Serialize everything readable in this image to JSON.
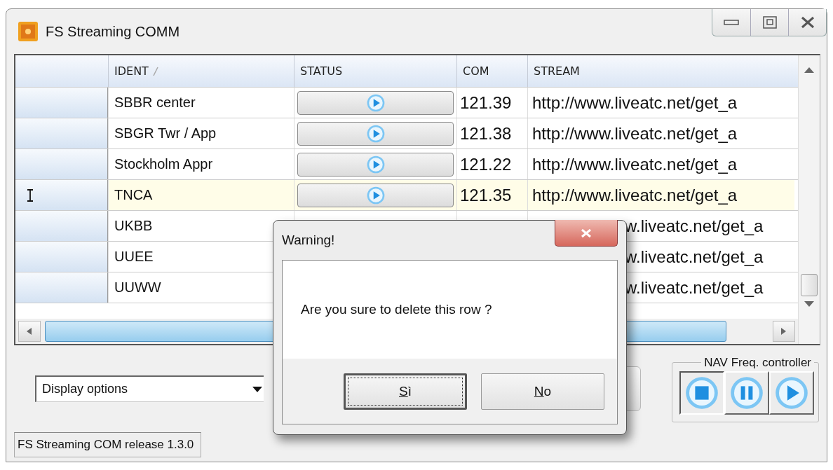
{
  "window": {
    "title": "FS Streaming COMM"
  },
  "table": {
    "columns": [
      {
        "label": "IDENT",
        "sorted": true
      },
      {
        "label": "STATUS",
        "sorted": false
      },
      {
        "label": "COM",
        "sorted": false
      },
      {
        "label": "STREAM",
        "sorted": false
      }
    ],
    "rows": [
      {
        "ident": "SBBR center",
        "com": "121.39",
        "stream": "http://www.liveatc.net/get_a",
        "selected": false
      },
      {
        "ident": "SBGR Twr / App",
        "com": "121.38",
        "stream": "http://www.liveatc.net/get_a",
        "selected": false
      },
      {
        "ident": "Stockholm Appr",
        "com": "121.22",
        "stream": "http://www.liveatc.net/get_a",
        "selected": false
      },
      {
        "ident": "TNCA",
        "com": "121.35",
        "stream": "http://www.liveatc.net/get_a",
        "selected": true
      },
      {
        "ident": "UKBB",
        "stream": "w.liveatc.net/get_a",
        "selected": false
      },
      {
        "ident": "UUEE",
        "stream": "w.liveatc.net/get_a",
        "selected": false
      },
      {
        "ident": "UUWW",
        "stream": "w.liveatc.net/get_a",
        "selected": false
      }
    ]
  },
  "display_options": {
    "value": "Display options"
  },
  "nav_controller": {
    "title": "NAV Freq. controller",
    "buttons": [
      {
        "kind": "stop",
        "selected": true
      },
      {
        "kind": "pause",
        "selected": false
      },
      {
        "kind": "play",
        "selected": false
      }
    ]
  },
  "status_bar": {
    "text": "FS Streaming COM release 1.3.0"
  },
  "dialog": {
    "title": "Warning!",
    "message": "Are you sure to delete this row ?",
    "buttons": [
      {
        "label": "Sì",
        "focused": true
      },
      {
        "label": "No",
        "focused": false
      }
    ]
  }
}
